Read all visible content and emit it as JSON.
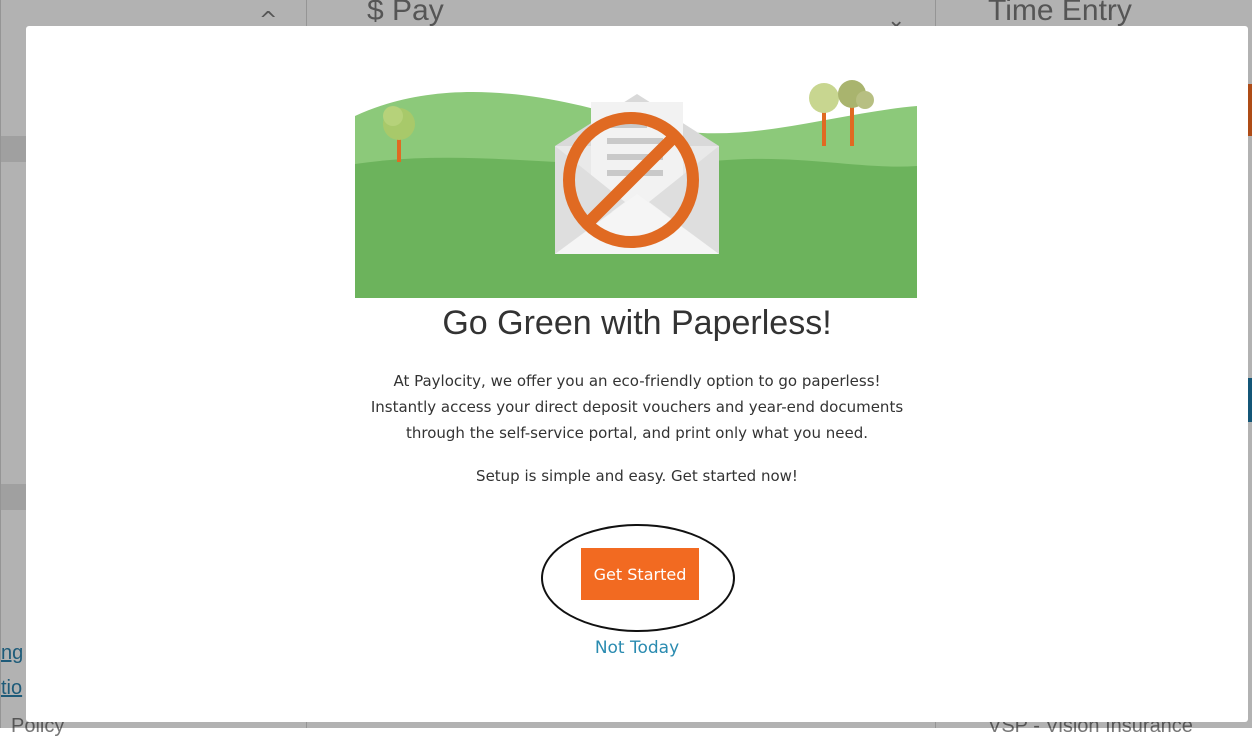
{
  "background": {
    "pay_title": "$ Pay",
    "time_entry_title": "Time Entry",
    "footer_left": "Policy",
    "footer_right": "VSP - Vision Insurance"
  },
  "modal": {
    "heading": "Go Green with Paperless!",
    "body_lines": [
      "At Paylocity, we offer you an eco-friendly option to go paperless!",
      "Instantly access your direct deposit vouchers and year-end documents",
      "through the self-service portal, and print only what you need."
    ],
    "subtext": "Setup is simple and easy. Get started now!",
    "primary_button": "Get Started",
    "secondary_link": "Not Today"
  },
  "colors": {
    "accent": "#f26a21",
    "link": "#2a8bb0",
    "illustration_green": "#6cb35c"
  }
}
